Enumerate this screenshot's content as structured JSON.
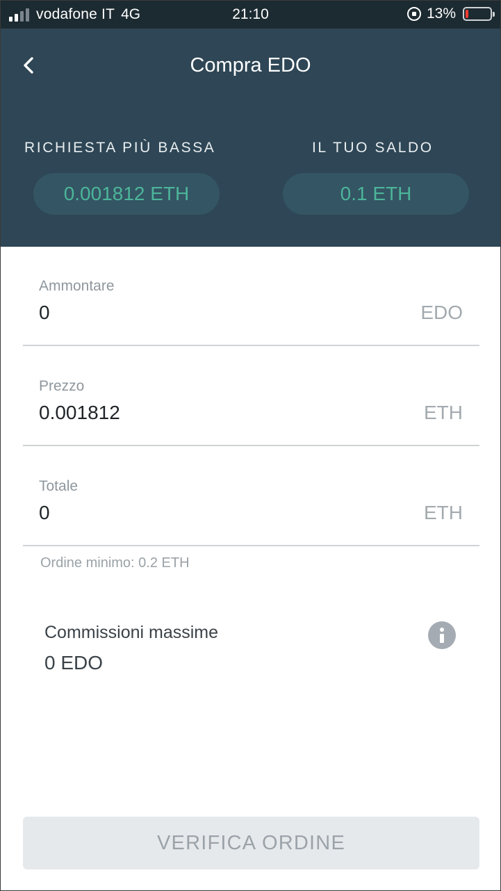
{
  "status_bar": {
    "carrier": "vodafone IT",
    "network": "4G",
    "time": "21:10",
    "battery": "13%",
    "battery_level": 0.13
  },
  "header": {
    "title": "Compra EDO",
    "lowest_ask_label": "RICHIESTA PIÙ BASSA",
    "lowest_ask_value": "0.001812 ETH",
    "balance_label": "IL TUO SALDO",
    "balance_value": "0.1 ETH"
  },
  "form": {
    "amount": {
      "label": "Ammontare",
      "value": "0",
      "unit": "EDO"
    },
    "price": {
      "label": "Prezzo",
      "value": "0.001812",
      "unit": "ETH"
    },
    "total": {
      "label": "Totale",
      "value": "0",
      "unit": "ETH"
    },
    "min_order_hint": "Ordine minimo: 0.2 ETH"
  },
  "fees": {
    "label": "Commissioni massime",
    "value": "0 EDO"
  },
  "actions": {
    "verify_label": "VERIFICA ORDINE"
  },
  "colors": {
    "header_bg": "#2e4655",
    "status_bg": "#1c2a31",
    "accent_green": "#4cb59a",
    "pill_bg": "#345563",
    "button_disabled_bg": "#e6e9ec",
    "battery_low": "#ff3b30"
  },
  "icons": {
    "back": "chevron-left-icon",
    "info": "info-icon",
    "rotation_lock": "rotation-lock-icon",
    "battery": "battery-icon",
    "signal": "signal-icon"
  }
}
